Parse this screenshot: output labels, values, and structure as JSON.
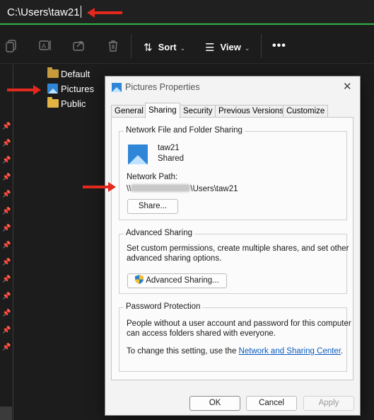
{
  "address_bar": {
    "path": "C:\\Users\\taw21"
  },
  "toolbar": {
    "sort_label": "Sort",
    "view_label": "View",
    "more_label": "•••",
    "icons": [
      "copy-icon",
      "rename-icon",
      "share-icon",
      "delete-icon",
      "sort-icon",
      "view-icon"
    ]
  },
  "tree": {
    "items": [
      {
        "label": "Default",
        "icon": "folder-icon"
      },
      {
        "label": "Pictures",
        "icon": "pictures-folder-icon"
      },
      {
        "label": "Public",
        "icon": "folder-icon"
      }
    ]
  },
  "annotation_color": "#e3281d",
  "dialog": {
    "title": "Pictures Properties",
    "close": "✕",
    "tabs": [
      "General",
      "Sharing",
      "Security",
      "Previous Versions",
      "Customize"
    ],
    "active_tab": "Sharing",
    "network_sharing": {
      "title": "Network File and Folder Sharing",
      "folder_name": "taw21",
      "status": "Shared",
      "network_path_label": "Network Path:",
      "path_prefix": "\\\\",
      "path_suffix": "\\Users\\taw21",
      "share_button": "Share..."
    },
    "advanced_sharing": {
      "title": "Advanced Sharing",
      "description_line1": "Set custom permissions, create multiple shares, and set other",
      "description_line2": "advanced sharing options.",
      "button": "Advanced Sharing..."
    },
    "password_protection": {
      "title": "Password Protection",
      "line1": "People without a user account and password for this computer",
      "line2": "can access folders shared with everyone.",
      "change_prefix": "To change this setting, use the ",
      "link": "Network and Sharing Center",
      "change_suffix": "."
    },
    "buttons": {
      "ok": "OK",
      "cancel": "Cancel",
      "apply": "Apply"
    }
  }
}
